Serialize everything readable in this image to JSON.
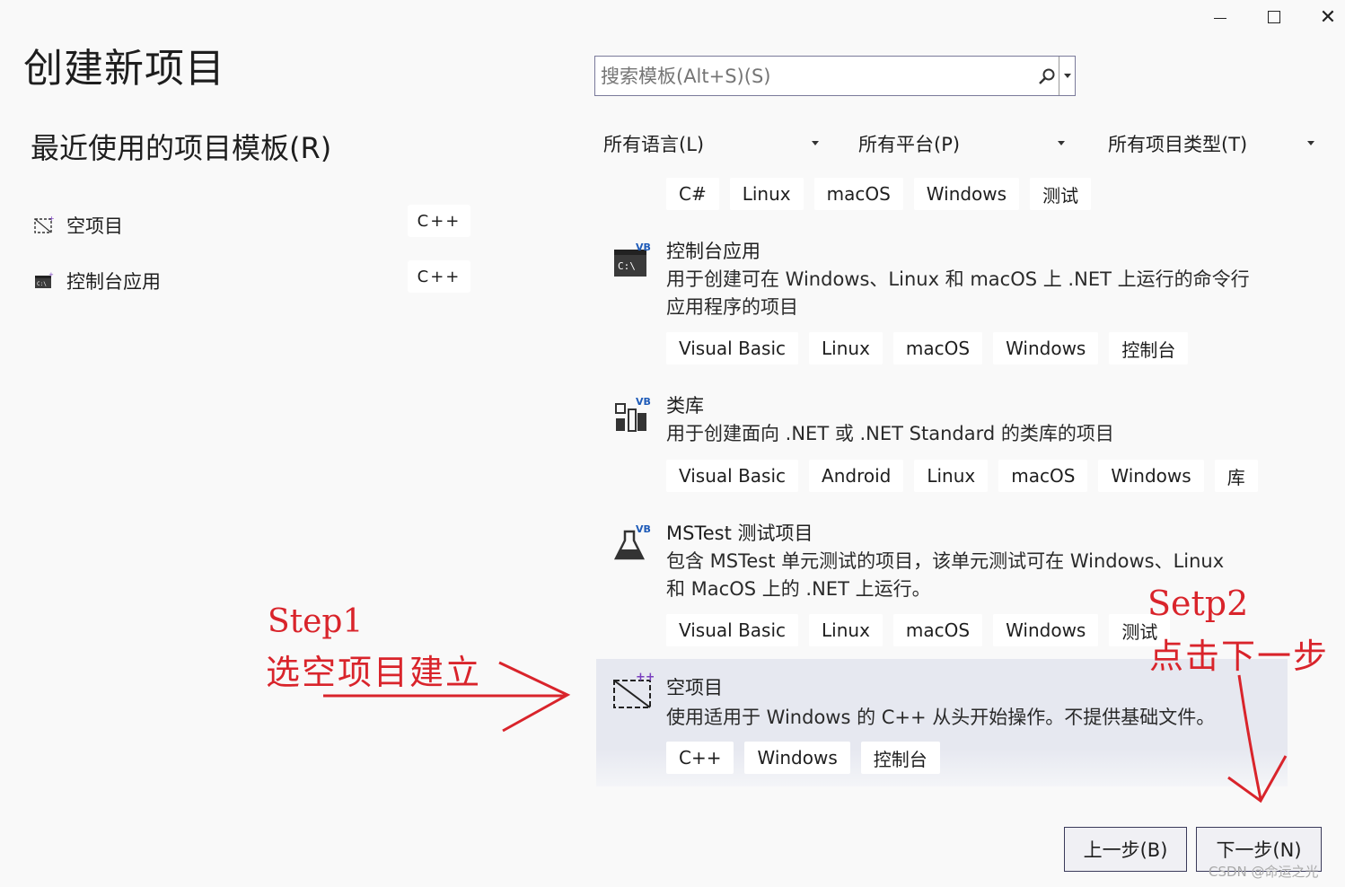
{
  "window": {
    "minimize_icon": "minimize-icon",
    "maximize_icon": "maximize-icon",
    "close_icon": "close-icon"
  },
  "page_title": "创建新项目",
  "recent": {
    "heading": "最近使用的项目模板(R)",
    "items": [
      {
        "label": "空项目",
        "lang": "C++",
        "icon": "empty-project-icon"
      },
      {
        "label": "控制台应用",
        "lang": "C++",
        "icon": "console-app-icon"
      }
    ]
  },
  "search": {
    "placeholder": "搜索模板(Alt+S)(S)",
    "icon": "search-icon"
  },
  "filters": {
    "language": "所有语言(L)",
    "platform": "所有平台(P)",
    "project_type": "所有项目类型(T)"
  },
  "top_partial_tags": [
    "C#",
    "Linux",
    "macOS",
    "Windows",
    "测试"
  ],
  "templates": [
    {
      "name": "控制台应用",
      "desc_lines": [
        "用于创建可在 Windows、Linux 和 macOS 上 .NET 上运行的命令行",
        "应用程序的项目"
      ],
      "tags": [
        "Visual Basic",
        "Linux",
        "macOS",
        "Windows",
        "控制台"
      ],
      "icon": "vb-console-app-icon",
      "badge": "VB"
    },
    {
      "name": "类库",
      "desc_lines": [
        "用于创建面向 .NET 或 .NET Standard 的类库的项目"
      ],
      "tags": [
        "Visual Basic",
        "Android",
        "Linux",
        "macOS",
        "Windows",
        "库"
      ],
      "icon": "vb-class-library-icon",
      "badge": "VB"
    },
    {
      "name": "MSTest 测试项目",
      "desc_lines": [
        "包含 MSTest 单元测试的项目，该单元测试可在 Windows、Linux",
        "和 MacOS 上的 .NET 上运行。"
      ],
      "tags": [
        "Visual Basic",
        "Linux",
        "macOS",
        "Windows",
        "测试"
      ],
      "icon": "vb-mstest-icon",
      "badge": "VB"
    },
    {
      "name": "空项目",
      "desc_lines": [
        "使用适用于 Windows 的 C++ 从头开始操作。不提供基础文件。"
      ],
      "tags": [
        "C++",
        "Windows",
        "控制台"
      ],
      "icon": "cpp-empty-project-icon",
      "badge": "++"
    }
  ],
  "annotations": {
    "step1_title": "Step1",
    "step1_text": "选空项目建立",
    "step2_title": "Setp2",
    "step2_text": "点击下一步",
    "color": "#d9242b"
  },
  "buttons": {
    "back": "上一步(B)",
    "next": "下一步(N)"
  },
  "watermark": "CSDN @命运之光"
}
